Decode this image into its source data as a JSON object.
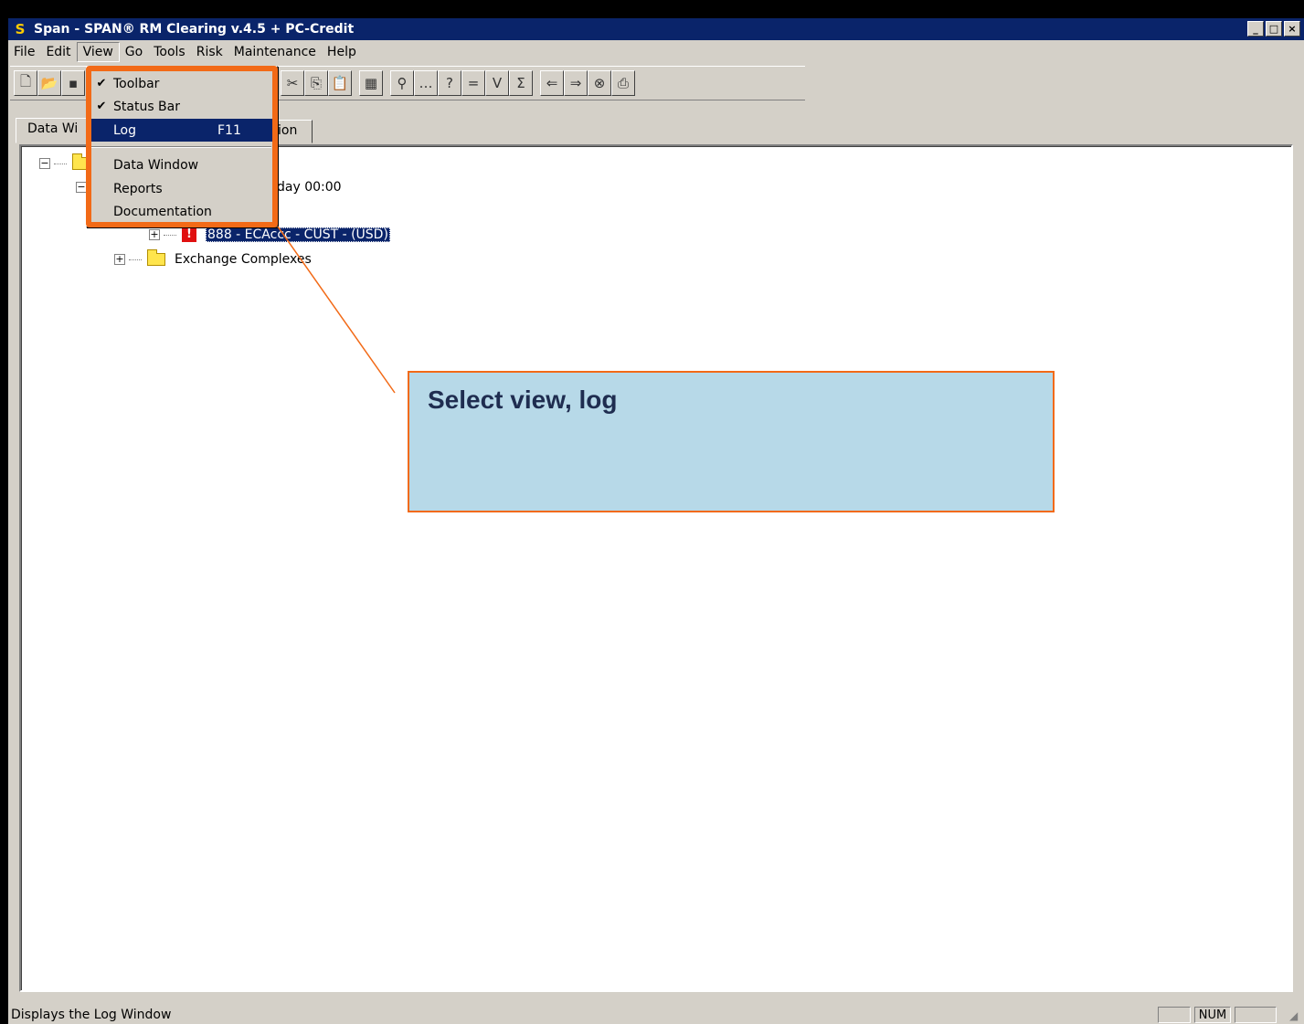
{
  "window": {
    "app_icon": "S",
    "title": "Span - SPAN® RM Clearing v.4.5 + PC-Credit",
    "controls": [
      "_",
      "□",
      "×"
    ]
  },
  "menubar": {
    "items": [
      {
        "label": "File"
      },
      {
        "label": "Edit"
      },
      {
        "label": "View"
      },
      {
        "label": "Go"
      },
      {
        "label": "Tools"
      },
      {
        "label": "Risk"
      },
      {
        "label": "Maintenance"
      },
      {
        "label": "Help"
      }
    ]
  },
  "toolbar": {
    "icons": [
      "new-icon",
      "open-icon",
      "save-icon",
      "cut-icon",
      "copy-icon",
      "paste-icon",
      "calculator-icon",
      "find-icon",
      "more-icon",
      "help-icon",
      "equals-icon",
      "v-icon",
      "sigma-icon",
      "back-icon",
      "forward-icon",
      "stop-icon",
      "print-icon"
    ]
  },
  "tabs": [
    {
      "label": "Data Wi"
    },
    {
      "label": "ion"
    }
  ],
  "tree": {
    "row_date_fragment": "day 00:00",
    "row_account": "888 - ECAccc - CUST - (USD)",
    "row_exchange": "Exchange Complexes"
  },
  "view_menu": {
    "items": [
      {
        "label": "Toolbar",
        "checked": true,
        "shortcut": ""
      },
      {
        "label": "Status Bar",
        "checked": true,
        "shortcut": ""
      },
      {
        "label": "Log",
        "checked": false,
        "shortcut": "F11",
        "highlighted": true
      },
      {
        "label": "Data Window",
        "checked": false,
        "shortcut": ""
      },
      {
        "label": "Reports",
        "checked": false,
        "shortcut": ""
      },
      {
        "label": "Documentation",
        "checked": false,
        "shortcut": ""
      }
    ]
  },
  "statusbar": {
    "text": "Displays the Log Window",
    "num_indicator": "NUM"
  },
  "callout": {
    "text": "Select view, log"
  },
  "colors": {
    "highlight_frame": "#f26a17",
    "callout_bg": "#b7d9e8",
    "selection": "#0a246a"
  }
}
